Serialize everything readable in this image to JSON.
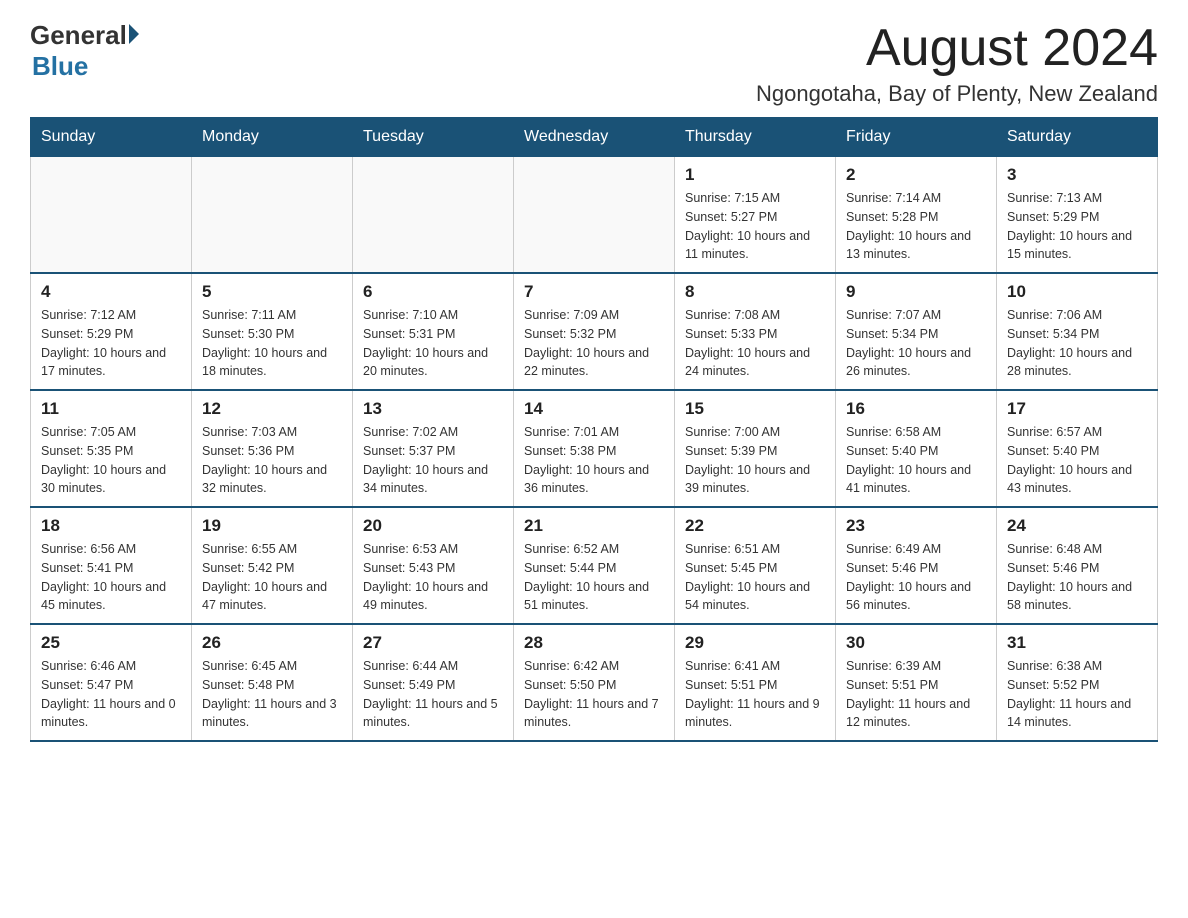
{
  "logo": {
    "general": "General",
    "blue": "Blue"
  },
  "title": "August 2024",
  "location": "Ngongotaha, Bay of Plenty, New Zealand",
  "days_header": [
    "Sunday",
    "Monday",
    "Tuesday",
    "Wednesday",
    "Thursday",
    "Friday",
    "Saturday"
  ],
  "weeks": [
    [
      {
        "day": "",
        "info": ""
      },
      {
        "day": "",
        "info": ""
      },
      {
        "day": "",
        "info": ""
      },
      {
        "day": "",
        "info": ""
      },
      {
        "day": "1",
        "info": "Sunrise: 7:15 AM\nSunset: 5:27 PM\nDaylight: 10 hours and 11 minutes."
      },
      {
        "day": "2",
        "info": "Sunrise: 7:14 AM\nSunset: 5:28 PM\nDaylight: 10 hours and 13 minutes."
      },
      {
        "day": "3",
        "info": "Sunrise: 7:13 AM\nSunset: 5:29 PM\nDaylight: 10 hours and 15 minutes."
      }
    ],
    [
      {
        "day": "4",
        "info": "Sunrise: 7:12 AM\nSunset: 5:29 PM\nDaylight: 10 hours and 17 minutes."
      },
      {
        "day": "5",
        "info": "Sunrise: 7:11 AM\nSunset: 5:30 PM\nDaylight: 10 hours and 18 minutes."
      },
      {
        "day": "6",
        "info": "Sunrise: 7:10 AM\nSunset: 5:31 PM\nDaylight: 10 hours and 20 minutes."
      },
      {
        "day": "7",
        "info": "Sunrise: 7:09 AM\nSunset: 5:32 PM\nDaylight: 10 hours and 22 minutes."
      },
      {
        "day": "8",
        "info": "Sunrise: 7:08 AM\nSunset: 5:33 PM\nDaylight: 10 hours and 24 minutes."
      },
      {
        "day": "9",
        "info": "Sunrise: 7:07 AM\nSunset: 5:34 PM\nDaylight: 10 hours and 26 minutes."
      },
      {
        "day": "10",
        "info": "Sunrise: 7:06 AM\nSunset: 5:34 PM\nDaylight: 10 hours and 28 minutes."
      }
    ],
    [
      {
        "day": "11",
        "info": "Sunrise: 7:05 AM\nSunset: 5:35 PM\nDaylight: 10 hours and 30 minutes."
      },
      {
        "day": "12",
        "info": "Sunrise: 7:03 AM\nSunset: 5:36 PM\nDaylight: 10 hours and 32 minutes."
      },
      {
        "day": "13",
        "info": "Sunrise: 7:02 AM\nSunset: 5:37 PM\nDaylight: 10 hours and 34 minutes."
      },
      {
        "day": "14",
        "info": "Sunrise: 7:01 AM\nSunset: 5:38 PM\nDaylight: 10 hours and 36 minutes."
      },
      {
        "day": "15",
        "info": "Sunrise: 7:00 AM\nSunset: 5:39 PM\nDaylight: 10 hours and 39 minutes."
      },
      {
        "day": "16",
        "info": "Sunrise: 6:58 AM\nSunset: 5:40 PM\nDaylight: 10 hours and 41 minutes."
      },
      {
        "day": "17",
        "info": "Sunrise: 6:57 AM\nSunset: 5:40 PM\nDaylight: 10 hours and 43 minutes."
      }
    ],
    [
      {
        "day": "18",
        "info": "Sunrise: 6:56 AM\nSunset: 5:41 PM\nDaylight: 10 hours and 45 minutes."
      },
      {
        "day": "19",
        "info": "Sunrise: 6:55 AM\nSunset: 5:42 PM\nDaylight: 10 hours and 47 minutes."
      },
      {
        "day": "20",
        "info": "Sunrise: 6:53 AM\nSunset: 5:43 PM\nDaylight: 10 hours and 49 minutes."
      },
      {
        "day": "21",
        "info": "Sunrise: 6:52 AM\nSunset: 5:44 PM\nDaylight: 10 hours and 51 minutes."
      },
      {
        "day": "22",
        "info": "Sunrise: 6:51 AM\nSunset: 5:45 PM\nDaylight: 10 hours and 54 minutes."
      },
      {
        "day": "23",
        "info": "Sunrise: 6:49 AM\nSunset: 5:46 PM\nDaylight: 10 hours and 56 minutes."
      },
      {
        "day": "24",
        "info": "Sunrise: 6:48 AM\nSunset: 5:46 PM\nDaylight: 10 hours and 58 minutes."
      }
    ],
    [
      {
        "day": "25",
        "info": "Sunrise: 6:46 AM\nSunset: 5:47 PM\nDaylight: 11 hours and 0 minutes."
      },
      {
        "day": "26",
        "info": "Sunrise: 6:45 AM\nSunset: 5:48 PM\nDaylight: 11 hours and 3 minutes."
      },
      {
        "day": "27",
        "info": "Sunrise: 6:44 AM\nSunset: 5:49 PM\nDaylight: 11 hours and 5 minutes."
      },
      {
        "day": "28",
        "info": "Sunrise: 6:42 AM\nSunset: 5:50 PM\nDaylight: 11 hours and 7 minutes."
      },
      {
        "day": "29",
        "info": "Sunrise: 6:41 AM\nSunset: 5:51 PM\nDaylight: 11 hours and 9 minutes."
      },
      {
        "day": "30",
        "info": "Sunrise: 6:39 AM\nSunset: 5:51 PM\nDaylight: 11 hours and 12 minutes."
      },
      {
        "day": "31",
        "info": "Sunrise: 6:38 AM\nSunset: 5:52 PM\nDaylight: 11 hours and 14 minutes."
      }
    ]
  ]
}
